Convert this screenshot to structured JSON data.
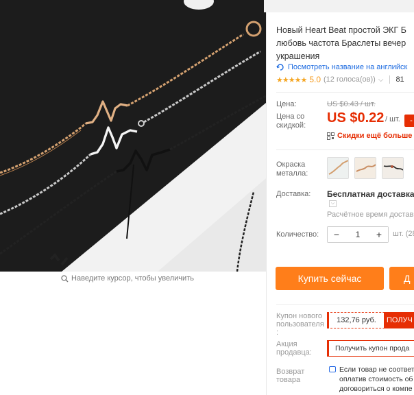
{
  "product": {
    "title_lines": [
      "Новый Heart Beat простой ЭКГ Б",
      "любовь частота Браслеты вечер",
      "украшения"
    ],
    "translate_link": "Посмотреть название на английск",
    "rating": {
      "stars": "★★★★★",
      "value": "5.0",
      "votes": "(12 голоса(ов))",
      "orders": "81"
    }
  },
  "gallery": {
    "zoom_hint": "Наведите курсор, чтобы увеличить"
  },
  "price": {
    "label": "Цена:",
    "old": "US $0.43 / шт.",
    "discount_label_1": "Цена со",
    "discount_label_2": "скидкой:",
    "current": "US $0.22",
    "unit": "/ шт.",
    "badge": "-",
    "promo": "Скидки ещё больше в"
  },
  "options": {
    "color_label_1": "Окраска",
    "color_label_2": "металла:",
    "swatches": [
      "rose-gold",
      "gold",
      "black"
    ]
  },
  "shipping": {
    "label": "Доставка:",
    "text": "Бесплатная доставка в",
    "time": "Расчётное время доставк"
  },
  "quantity": {
    "label": "Количество:",
    "minus": "−",
    "value": "1",
    "plus": "+",
    "available": "шт. (28"
  },
  "actions": {
    "buy_now": "Купить сейчас",
    "add_cart": "Д"
  },
  "coupons": {
    "new_user_label_1": "Купон нового",
    "new_user_label_2": "пользователя",
    "new_user_label_3": ":",
    "new_user_amount": "132,76 руб.",
    "new_user_get": "ПОЛУЧ",
    "seller_label_1": "Акция",
    "seller_label_2": "продавца:",
    "seller_button": "Получить купон прода",
    "return_label_1": "Возврат",
    "return_label_2": "товара",
    "return_lines": [
      "Если товар не соответ",
      "оплатив стоимость об",
      "договориться о компе"
    ]
  },
  "colors": {
    "accent": "#e62e04",
    "buy": "#ff7e1a",
    "link": "#1d6be0",
    "star": "#f5a623"
  }
}
